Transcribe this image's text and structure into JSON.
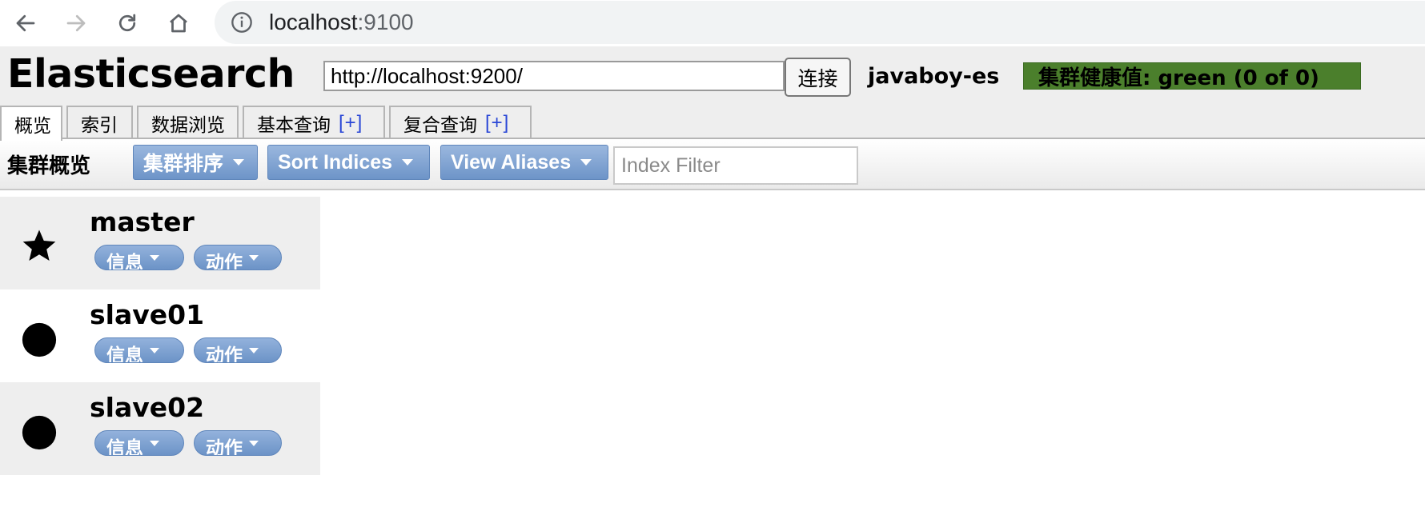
{
  "browser": {
    "url_host": "localhost",
    "url_port": ":9100",
    "icons": [
      "back-arrow-icon",
      "forward-arrow-icon",
      "reload-icon",
      "home-icon",
      "info-icon"
    ]
  },
  "app": {
    "title": "Elasticsearch",
    "connection_url": "http://localhost:9200/",
    "connect_label": "连接",
    "cluster_name": "javaboy-es",
    "health_text": "集群健康值: green (0 of 0)",
    "health_color": "#4b7f2c"
  },
  "tabs": [
    {
      "label": "概览",
      "plus": ""
    },
    {
      "label": "索引",
      "plus": ""
    },
    {
      "label": "数据浏览",
      "plus": ""
    },
    {
      "label": "基本查询",
      "plus": "[+]"
    },
    {
      "label": "复合查询",
      "plus": "[+]"
    }
  ],
  "toolbar": {
    "title": "集群概览",
    "sort_cluster_label": "集群排序",
    "sort_indices_label": "Sort Indices",
    "view_aliases_label": "View Aliases",
    "index_filter_placeholder": "Index Filter"
  },
  "nodes": [
    {
      "name": "master",
      "role_icon": "star-icon",
      "info_label": "信息",
      "action_label": "动作"
    },
    {
      "name": "slave01",
      "role_icon": "circle-icon",
      "info_label": "信息",
      "action_label": "动作"
    },
    {
      "name": "slave02",
      "role_icon": "circle-icon",
      "info_label": "信息",
      "action_label": "动作"
    }
  ],
  "colors": {
    "accent_button": "#6d94c8",
    "link_plus": "#2a47d6"
  }
}
